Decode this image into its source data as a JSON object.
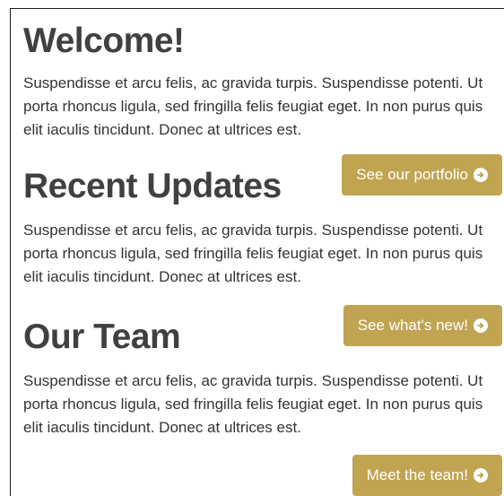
{
  "colors": {
    "button_bg": "#c0a451",
    "heading": "#404040",
    "body_text": "#333333"
  },
  "sections": [
    {
      "heading": "Welcome!",
      "text": "Suspendisse et arcu felis, ac gravida turpis. Suspendisse potenti. Ut porta rhoncus ligula, sed fringilla felis feugiat eget. In non purus quis elit iaculis tincidunt. Donec at ultrices est.",
      "button_label": "See our portfolio",
      "button_icon": "arrow-circle-right-icon"
    },
    {
      "heading": "Recent Updates",
      "text": "Suspendisse et arcu felis, ac gravida turpis. Suspendisse potenti. Ut porta rhoncus ligula, sed fringilla felis feugiat eget. In non purus quis elit iaculis tincidunt. Donec at ultrices est.",
      "button_label": "See what's new!",
      "button_icon": "arrow-circle-right-icon"
    },
    {
      "heading": "Our Team",
      "text": "Suspendisse et arcu felis, ac gravida turpis. Suspendisse potenti. Ut porta rhoncus ligula, sed fringilla felis feugiat eget. In non purus quis elit iaculis tincidunt. Donec at ultrices est.",
      "button_label": "Meet the team!",
      "button_icon": "arrow-circle-right-icon"
    }
  ]
}
